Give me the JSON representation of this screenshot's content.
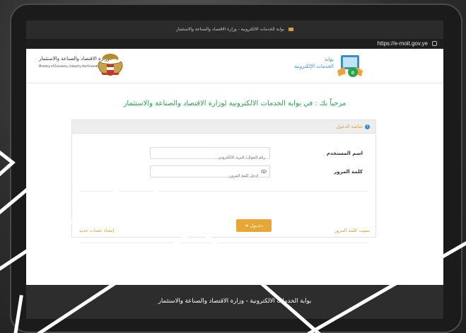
{
  "browser": {
    "tab_title": "بوابة الخدمات الالكترونية - وزارة الاقتصاد والصناعة والاستثمار",
    "url": "https://e-moit.gov.ye"
  },
  "header": {
    "ministry_name_ar": "وزارة الاقتصاد والصناعة والاستثمار",
    "ministry_name_en": "Ministry of Economy, Industry And Investment",
    "portal_line1": "بوابة",
    "portal_line2": "الخدمات الإلكترونية"
  },
  "welcome": "مرحباً بك : في بوابة الخدمات الالكترونية لوزارة الاقتصاد والصناعة والاستثمار",
  "login_panel": {
    "title": "شاشة الدخول",
    "username_label": "اسم المستخدم",
    "username_placeholder": "رقم الجوال/ البريد الالكتروني",
    "password_label": "كلمة المرور",
    "password_placeholder": "ادخل كلمة المرور",
    "login_button": "دخــول",
    "forgot_password": "نسيت كلمة المرور",
    "create_account": "إنشاء حساب جديد"
  },
  "footer": {
    "text": "بوابة الخدمات الالكترونية - وزارة الاقتصاد والصناعة والاستثمار"
  },
  "colors": {
    "accent_green": "#27a44c",
    "accent_gold": "#e7a736",
    "portal_blue": "#3a8fc8",
    "footer_bg": "#2d2d2d"
  }
}
